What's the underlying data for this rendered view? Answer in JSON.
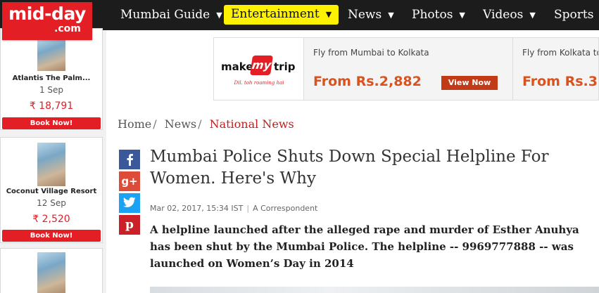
{
  "logo": {
    "main": "mid-day",
    "sub": ".com"
  },
  "nav": {
    "items": [
      {
        "label": "Mumbai Guide"
      },
      {
        "label": "Entertainment"
      },
      {
        "label": "News"
      },
      {
        "label": "Photos"
      },
      {
        "label": "Videos"
      },
      {
        "label": "Sports"
      }
    ],
    "caret": "▼"
  },
  "sidebar": {
    "hotels": [
      {
        "name": "Atlantis The Palm...",
        "date": "1 Sep",
        "price": "₹ 18,791",
        "cta": "Book Now!"
      },
      {
        "name": "Coconut Village Resort",
        "date": "12 Sep",
        "price": "₹ 2,520",
        "cta": "Book Now!"
      },
      {
        "name": "",
        "date": "",
        "price": "",
        "cta": ""
      }
    ]
  },
  "ad": {
    "brand_make": "make",
    "brand_my": "my",
    "brand_trip": "trip",
    "tagline": "Dil. toh roaming hai",
    "offers": [
      {
        "route": "Fly from Mumbai to Kolkata",
        "price": "From Rs.2,882",
        "cta": "View Now"
      },
      {
        "route": "Fly from Kolkata to Mumbai",
        "price": "From Rs.3,",
        "cta": ""
      }
    ]
  },
  "breadcrumb": {
    "items": [
      "Home",
      "News",
      "National News"
    ],
    "separator": "/"
  },
  "share": {
    "icons": [
      "facebook-icon",
      "google-plus-icon",
      "twitter-icon",
      "pinterest-icon"
    ],
    "colors": [
      "#3b5998",
      "#dd4b39",
      "#1da1f2",
      "#cb2027"
    ],
    "gplus_text": "g+",
    "pinterest_text": "p"
  },
  "article": {
    "headline": "Mumbai Police Shuts Down Special Helpline For Women. Here's Why",
    "date": "Mar 02, 2017, 15:34 IST",
    "meta_sep": "|",
    "author": "A Correspondent",
    "summary": "A helpline launched after the alleged rape and murder of Esther Anuhya has been shut by the Mumbai Police. The helpline -- 9969777888 -- was launched on Women’s Day in 2014"
  },
  "colors": {
    "brand_red": "#e31e24",
    "nav_bg": "#1c1c1c",
    "nav_active": "#fff200",
    "breadcrumb_current": "#c41e1e",
    "ad_price": "#d9531e"
  }
}
